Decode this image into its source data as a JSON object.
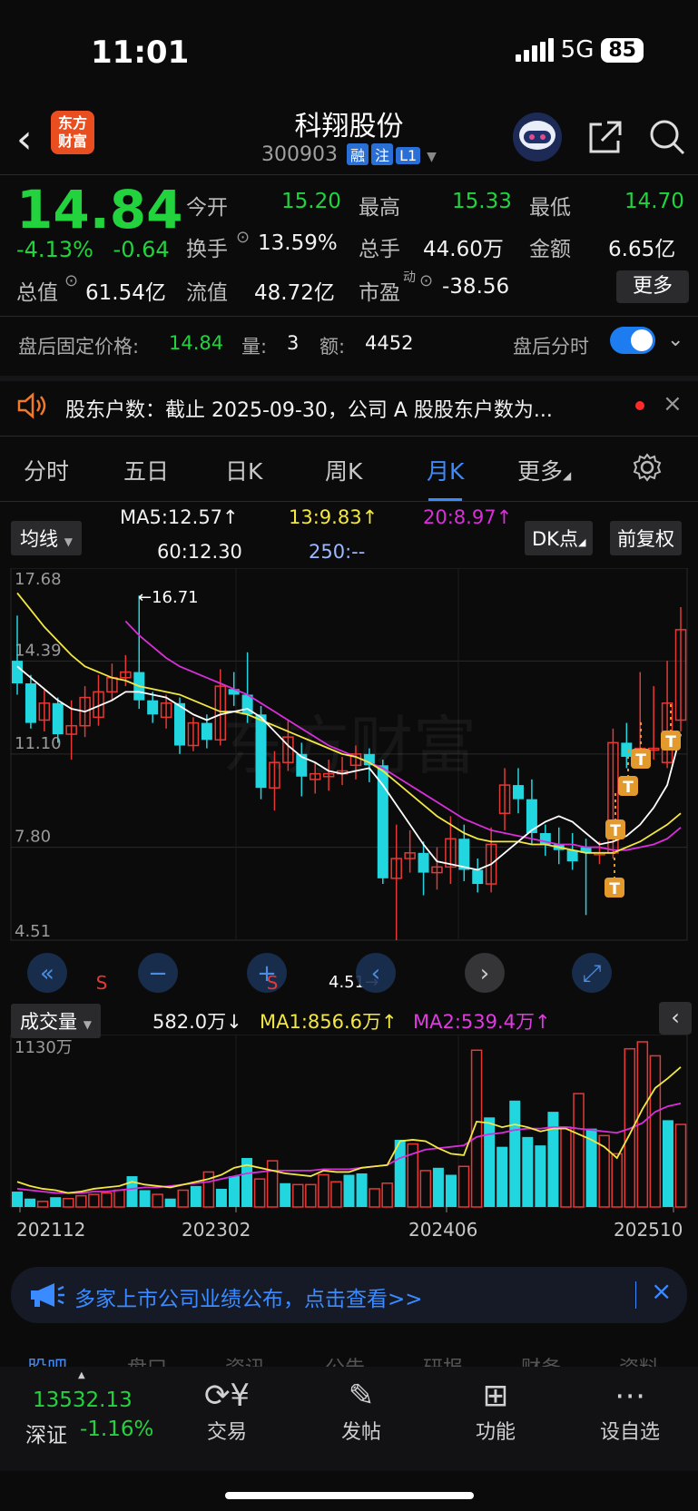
{
  "status": {
    "time": "11:01",
    "network": "5G",
    "battery": "85"
  },
  "header": {
    "logo_line1": "东方",
    "logo_line2": "财富",
    "title": "科翔股份",
    "code": "300903",
    "tags": [
      "融",
      "注",
      "L1"
    ]
  },
  "quote": {
    "price": "14.84",
    "change_pct": "-4.13%",
    "change_abs": "-0.64",
    "open_label": "今开",
    "open": "15.20",
    "high_label": "最高",
    "high": "15.33",
    "low_label": "最低",
    "low": "14.70",
    "turnover_label": "换手",
    "turnover": "13.59%",
    "volume_label": "总手",
    "volume": "44.60万",
    "amount_label": "金额",
    "amount": "6.65亿",
    "mktcap_label": "总值",
    "mktcap": "61.54亿",
    "float_label": "流值",
    "float": "48.72亿",
    "pe_label": "市盈",
    "pe_sup": "动",
    "pe": "-38.56",
    "more": "更多"
  },
  "afterhours": {
    "price_label": "盘后固定价格:",
    "price": "14.84",
    "vol_label": "量:",
    "vol": "3",
    "amt_label": "额:",
    "amt": "4452",
    "timeshare": "盘后分时"
  },
  "notice": {
    "text": "股东户数：截止 2025-09-30，公司 A 股股东户数为..."
  },
  "tabs": [
    "分时",
    "五日",
    "日K",
    "周K",
    "月K",
    "更多"
  ],
  "ma": {
    "selector": "均线",
    "ma5": "MA5:12.57",
    "ma13": "13:9.83",
    "ma20": "20:8.97",
    "ma60": "60:12.30",
    "ma250": "250:--",
    "dk": "DK点",
    "fq": "前复权"
  },
  "price_axis": [
    "17.68",
    "14.39",
    "11.10",
    "7.80",
    "4.51"
  ],
  "annotations": {
    "high": "←16.71",
    "low": "4.51→",
    "s_mark": "S"
  },
  "volume": {
    "selector": "成交量",
    "last": "582.0万",
    "ma1": "MA1:856.6万",
    "ma2": "MA2:539.4万",
    "axis_top": "1130万"
  },
  "x_axis": [
    "202112",
    "202302",
    "202406",
    "202510"
  ],
  "banner": {
    "text": "多家上市公司业绩公布，点击查看>>"
  },
  "bottom_tabs_hidden": [
    "股吧",
    "盘口",
    "资讯",
    "公告",
    "研报",
    "财务",
    "资料"
  ],
  "bottom": {
    "index_value": "13532.13",
    "index_name": "深证",
    "index_chg": "-1.16%",
    "items": [
      "交易",
      "发帖",
      "功能",
      "设自选"
    ]
  },
  "colors": {
    "up": "#e53935",
    "down": "#22d6e0",
    "ma5": "#ffffff",
    "ma13": "#f3e741",
    "ma20": "#d92fd9",
    "accent": "#3a8bff"
  },
  "candles": [
    {
      "o": 14.4,
      "c": 13.6,
      "h": 16.0,
      "l": 13.2
    },
    {
      "o": 13.6,
      "c": 12.2,
      "h": 13.9,
      "l": 12.0
    },
    {
      "o": 12.3,
      "c": 12.9,
      "h": 13.4,
      "l": 11.9
    },
    {
      "o": 12.9,
      "c": 11.8,
      "h": 13.1,
      "l": 11.5
    },
    {
      "o": 11.8,
      "c": 12.1,
      "h": 13.0,
      "l": 10.9
    },
    {
      "o": 12.1,
      "c": 13.1,
      "h": 13.5,
      "l": 11.7
    },
    {
      "o": 12.4,
      "c": 13.3,
      "h": 13.9,
      "l": 12.1
    },
    {
      "o": 13.3,
      "c": 13.8,
      "h": 14.3,
      "l": 13.0
    },
    {
      "o": 13.8,
      "c": 14.0,
      "h": 14.6,
      "l": 13.5
    },
    {
      "o": 14.0,
      "c": 13.0,
      "h": 16.71,
      "l": 12.7
    },
    {
      "o": 13.0,
      "c": 12.5,
      "h": 13.3,
      "l": 12.2
    },
    {
      "o": 12.4,
      "c": 12.9,
      "h": 13.2,
      "l": 12.0
    },
    {
      "o": 12.9,
      "c": 11.4,
      "h": 13.1,
      "l": 11.1
    },
    {
      "o": 11.4,
      "c": 12.2,
      "h": 12.4,
      "l": 11.2
    },
    {
      "o": 12.2,
      "c": 11.6,
      "h": 12.5,
      "l": 11.3
    },
    {
      "o": 11.6,
      "c": 13.5,
      "h": 14.1,
      "l": 11.4
    },
    {
      "o": 13.4,
      "c": 13.2,
      "h": 14.0,
      "l": 12.8
    },
    {
      "o": 13.2,
      "c": 12.5,
      "h": 14.7,
      "l": 12.2
    },
    {
      "o": 12.5,
      "c": 9.9,
      "h": 12.8,
      "l": 9.5
    },
    {
      "o": 9.9,
      "c": 10.8,
      "h": 11.2,
      "l": 9.1
    },
    {
      "o": 10.8,
      "c": 11.7,
      "h": 12.3,
      "l": 10.5
    },
    {
      "o": 11.1,
      "c": 10.3,
      "h": 11.5,
      "l": 9.6
    },
    {
      "o": 10.2,
      "c": 10.4,
      "h": 10.8,
      "l": 9.7
    },
    {
      "o": 10.3,
      "c": 10.4,
      "h": 10.9,
      "l": 9.8
    },
    {
      "o": 10.4,
      "c": 10.5,
      "h": 11.0,
      "l": 10.0
    },
    {
      "o": 10.7,
      "c": 11.1,
      "h": 11.4,
      "l": 10.2
    },
    {
      "o": 11.1,
      "c": 10.7,
      "h": 11.3,
      "l": 10.1
    },
    {
      "o": 10.7,
      "c": 6.7,
      "h": 10.9,
      "l": 6.5
    },
    {
      "o": 6.7,
      "c": 7.4,
      "h": 8.6,
      "l": 4.51
    },
    {
      "o": 7.4,
      "c": 7.6,
      "h": 8.4,
      "l": 6.9
    },
    {
      "o": 7.6,
      "c": 6.9,
      "h": 8.0,
      "l": 6.1
    },
    {
      "o": 6.9,
      "c": 7.1,
      "h": 7.8,
      "l": 6.3
    },
    {
      "o": 7.1,
      "c": 8.1,
      "h": 8.9,
      "l": 6.5
    },
    {
      "o": 8.1,
      "c": 7.0,
      "h": 8.6,
      "l": 6.6
    },
    {
      "o": 7.0,
      "c": 6.5,
      "h": 7.4,
      "l": 6.2
    },
    {
      "o": 6.5,
      "c": 7.9,
      "h": 8.5,
      "l": 6.2
    },
    {
      "o": 9.0,
      "c": 10.0,
      "h": 10.6,
      "l": 8.4
    },
    {
      "o": 10.0,
      "c": 9.5,
      "h": 10.6,
      "l": 9.0
    },
    {
      "o": 9.5,
      "c": 8.3,
      "h": 10.2,
      "l": 7.9
    },
    {
      "o": 8.3,
      "c": 7.9,
      "h": 8.6,
      "l": 7.5
    },
    {
      "o": 7.9,
      "c": 7.7,
      "h": 8.5,
      "l": 7.2
    },
    {
      "o": 7.7,
      "c": 7.3,
      "h": 8.3,
      "l": 7.0
    },
    {
      "o": 7.8,
      "c": 7.6,
      "h": 8.1,
      "l": 5.4
    },
    {
      "o": 7.6,
      "c": 7.6,
      "h": 8.0,
      "l": 7.2
    },
    {
      "o": 7.6,
      "c": 11.5,
      "h": 12.0,
      "l": 7.4
    },
    {
      "o": 11.5,
      "c": 11.0,
      "h": 12.2,
      "l": 10.6
    },
    {
      "o": 11.0,
      "c": 11.3,
      "h": 14.0,
      "l": 10.8
    },
    {
      "o": 11.3,
      "c": 11.3,
      "h": 13.5,
      "l": 10.9
    },
    {
      "o": 10.8,
      "c": 12.9,
      "h": 14.4,
      "l": 10.6
    },
    {
      "o": 12.3,
      "c": 15.5,
      "h": 16.3,
      "l": 11.9
    }
  ],
  "ma_lines": {
    "ma5": [
      14.2,
      13.8,
      13.4,
      13.0,
      12.7,
      12.6,
      12.8,
      13.0,
      13.3,
      13.3,
      13.2,
      13.1,
      12.8,
      12.5,
      12.3,
      12.5,
      12.6,
      12.7,
      12.4,
      11.9,
      11.4,
      11.0,
      10.8,
      10.5,
      10.4,
      10.5,
      10.6,
      10.0,
      9.3,
      8.6,
      7.9,
      7.3,
      7.2,
      7.1,
      7.0,
      7.2,
      7.6,
      8.0,
      8.4,
      8.7,
      8.9,
      8.7,
      8.3,
      7.9,
      8.0,
      8.2,
      8.6,
      9.2,
      10.0,
      11.8
    ],
    "ma13": [
      16.8,
      16.2,
      15.6,
      15.1,
      14.6,
      14.2,
      14.0,
      13.8,
      13.7,
      13.5,
      13.4,
      13.3,
      13.2,
      13.0,
      12.8,
      12.6,
      12.6,
      12.5,
      12.3,
      12.1,
      11.9,
      11.7,
      11.5,
      11.3,
      11.1,
      11.0,
      10.8,
      10.5,
      10.1,
      9.7,
      9.3,
      8.9,
      8.6,
      8.3,
      8.1,
      8.0,
      8.0,
      8.0,
      7.9,
      7.9,
      7.8,
      7.7,
      7.6,
      7.6,
      7.6,
      7.8,
      8.0,
      8.3,
      8.6,
      9.0
    ],
    "ma20": [
      null,
      null,
      null,
      null,
      null,
      null,
      null,
      null,
      15.8,
      15.3,
      14.9,
      14.5,
      14.2,
      14.0,
      13.8,
      13.6,
      13.4,
      13.2,
      12.9,
      12.6,
      12.3,
      12.0,
      11.7,
      11.4,
      11.2,
      11.0,
      10.8,
      10.6,
      10.3,
      10.0,
      9.7,
      9.4,
      9.1,
      8.8,
      8.6,
      8.4,
      8.3,
      8.2,
      8.1,
      8.0,
      7.9,
      7.9,
      7.8,
      7.8,
      7.7,
      7.7,
      7.8,
      7.9,
      8.1,
      8.5
    ]
  },
  "volumes": [
    110,
    60,
    40,
    70,
    60,
    80,
    90,
    100,
    120,
    220,
    120,
    90,
    60,
    120,
    150,
    250,
    130,
    220,
    350,
    200,
    330,
    170,
    160,
    160,
    230,
    180,
    230,
    240,
    130,
    170,
    480,
    450,
    260,
    280,
    230,
    290,
    1120,
    640,
    430,
    760,
    500,
    440,
    680,
    570,
    810,
    560,
    510,
    380,
    1130,
    1180,
    1080,
    620,
    590
  ],
  "vol_ma1": [
    180,
    150,
    130,
    120,
    100,
    110,
    130,
    140,
    150,
    180,
    160,
    150,
    140,
    160,
    180,
    200,
    230,
    280,
    300,
    280,
    260,
    240,
    230,
    220,
    260,
    250,
    250,
    280,
    290,
    300,
    470,
    480,
    470,
    420,
    380,
    370,
    610,
    600,
    570,
    590,
    570,
    540,
    560,
    560,
    520,
    480,
    430,
    350,
    520,
    700,
    850,
    920,
    1000
  ],
  "vol_ma2": [
    130,
    120,
    110,
    100,
    100,
    100,
    110,
    110,
    120,
    130,
    140,
    140,
    150,
    160,
    170,
    180,
    200,
    220,
    240,
    250,
    260,
    260,
    260,
    260,
    270,
    270,
    270,
    280,
    290,
    300,
    350,
    380,
    410,
    420,
    430,
    440,
    500,
    520,
    530,
    550,
    560,
    560,
    570,
    570,
    560,
    550,
    540,
    530,
    560,
    600,
    680,
    720,
    740
  ]
}
